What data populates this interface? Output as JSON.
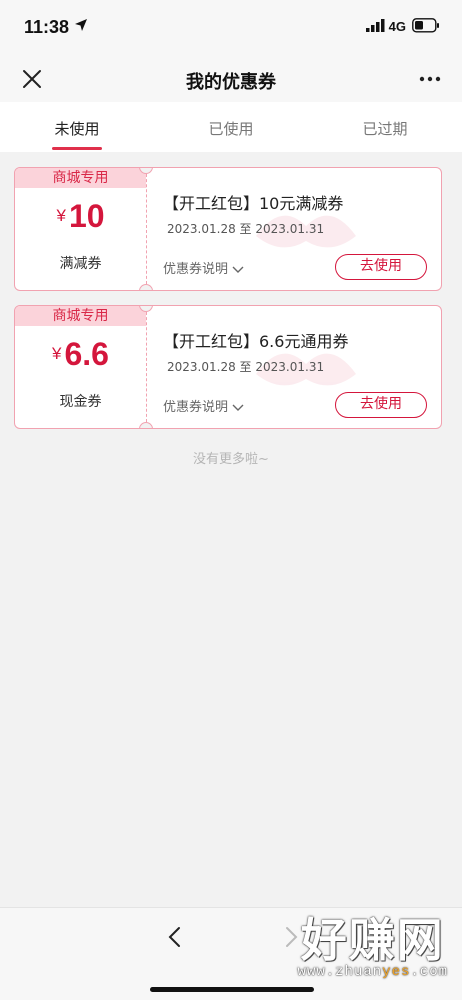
{
  "status_bar": {
    "time": "11:38",
    "network": "4G"
  },
  "nav": {
    "title": "我的优惠券"
  },
  "tabs": [
    {
      "label": "未使用",
      "active": true
    },
    {
      "label": "已使用",
      "active": false
    },
    {
      "label": "已过期",
      "active": false
    }
  ],
  "coupons": [
    {
      "tag": "商城专用",
      "currency": "¥",
      "amount": "10",
      "type": "满减券",
      "title": "【开工红包】10元满减券",
      "date_start": "2023.01.28",
      "date_sep": "至",
      "date_end": "2023.01.31",
      "info_label": "优惠券说明",
      "action_label": "去使用"
    },
    {
      "tag": "商城专用",
      "currency": "¥",
      "amount": "6.6",
      "type": "现金券",
      "title": "【开工红包】6.6元通用券",
      "date_start": "2023.01.28",
      "date_sep": "至",
      "date_end": "2023.01.31",
      "info_label": "优惠券说明",
      "action_label": "去使用"
    }
  ],
  "footer_note": "没有更多啦~",
  "watermark": {
    "main": "好赚网",
    "sub_a": "www.zhuan",
    "sub_b": "yes",
    "sub_c": ".com"
  },
  "colors": {
    "accent": "#d4163c",
    "tag_bg": "#fbd3da",
    "tab_underline": "#e0304b"
  }
}
